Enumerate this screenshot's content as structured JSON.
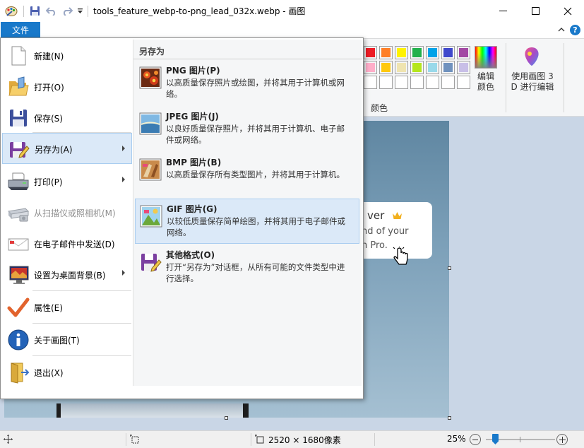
{
  "titlebar": {
    "title": "tools_feature_webp-to-png_lead_032x.webp - 画图"
  },
  "ribbon": {
    "file_tab": "文件",
    "colors_group_label": "颜色",
    "edit_colors_label_1": "编辑",
    "edit_colors_label_2": "颜色",
    "paint3d_label_1": "使用画图 3",
    "paint3d_label_2": "D 进行编辑",
    "palette_row1": [
      "#ed1c24",
      "#ff7f27",
      "#fff200",
      "#22b14c",
      "#00a2e8",
      "#3f48cc",
      "#a349a4"
    ],
    "palette_row2": [
      "#ffaec9",
      "#ffc90e",
      "#efe4b0",
      "#b5e61d",
      "#99d9ea",
      "#7092be",
      "#c8bfe7"
    ]
  },
  "file_menu": {
    "items": [
      {
        "label": "新建(N)",
        "icon": "new-icon"
      },
      {
        "label": "打开(O)",
        "icon": "open-folder-icon"
      },
      {
        "label": "保存(S)",
        "icon": "save-icon"
      },
      {
        "label": "另存为(A)",
        "icon": "save-as-icon"
      },
      {
        "label": "打印(P)",
        "icon": "printer-icon"
      },
      {
        "label": "从扫描仪或照相机(M)",
        "icon": "scanner-icon"
      },
      {
        "label": "在电子邮件中发送(D)",
        "icon": "email-icon"
      },
      {
        "label": "设置为桌面背景(B)",
        "icon": "desktop-icon"
      },
      {
        "label": "属性(E)",
        "icon": "checkmark-icon"
      },
      {
        "label": "关于画图(T)",
        "icon": "info-icon"
      },
      {
        "label": "退出(X)",
        "icon": "exit-icon"
      }
    ]
  },
  "save_as_submenu": {
    "title": "另存为",
    "items": [
      {
        "title": "PNG 图片(P)",
        "description": "以高质量保存照片或绘图，并将其用于计算机或网络。",
        "icon": "png-icon"
      },
      {
        "title": "JPEG 图片(J)",
        "description": "以良好质量保存照片，并将其用于计算机、电子邮件或网络。",
        "icon": "jpeg-icon"
      },
      {
        "title": "BMP 图片(B)",
        "description": "以高质量保存所有类型图片，并将其用于计算机。",
        "icon": "bmp-icon"
      },
      {
        "title": "GIF 图片(G)",
        "description": "以较低质量保存简单绘图，并将其用于电子邮件或网络。",
        "icon": "gif-icon"
      },
      {
        "title": "其他格式(O)",
        "description": "打开“另存为”对话框，从所有可能的文件类型中进行选择。",
        "icon": "other-format-icon"
      }
    ]
  },
  "canvas": {
    "tooltip_line1": "ver",
    "tooltip_line2": "nd of your",
    "tooltip_line3": "n Pro."
  },
  "statusbar": {
    "image_size": "2520 × 1680像素",
    "zoom": "25%",
    "zoom_level": 0.25
  }
}
